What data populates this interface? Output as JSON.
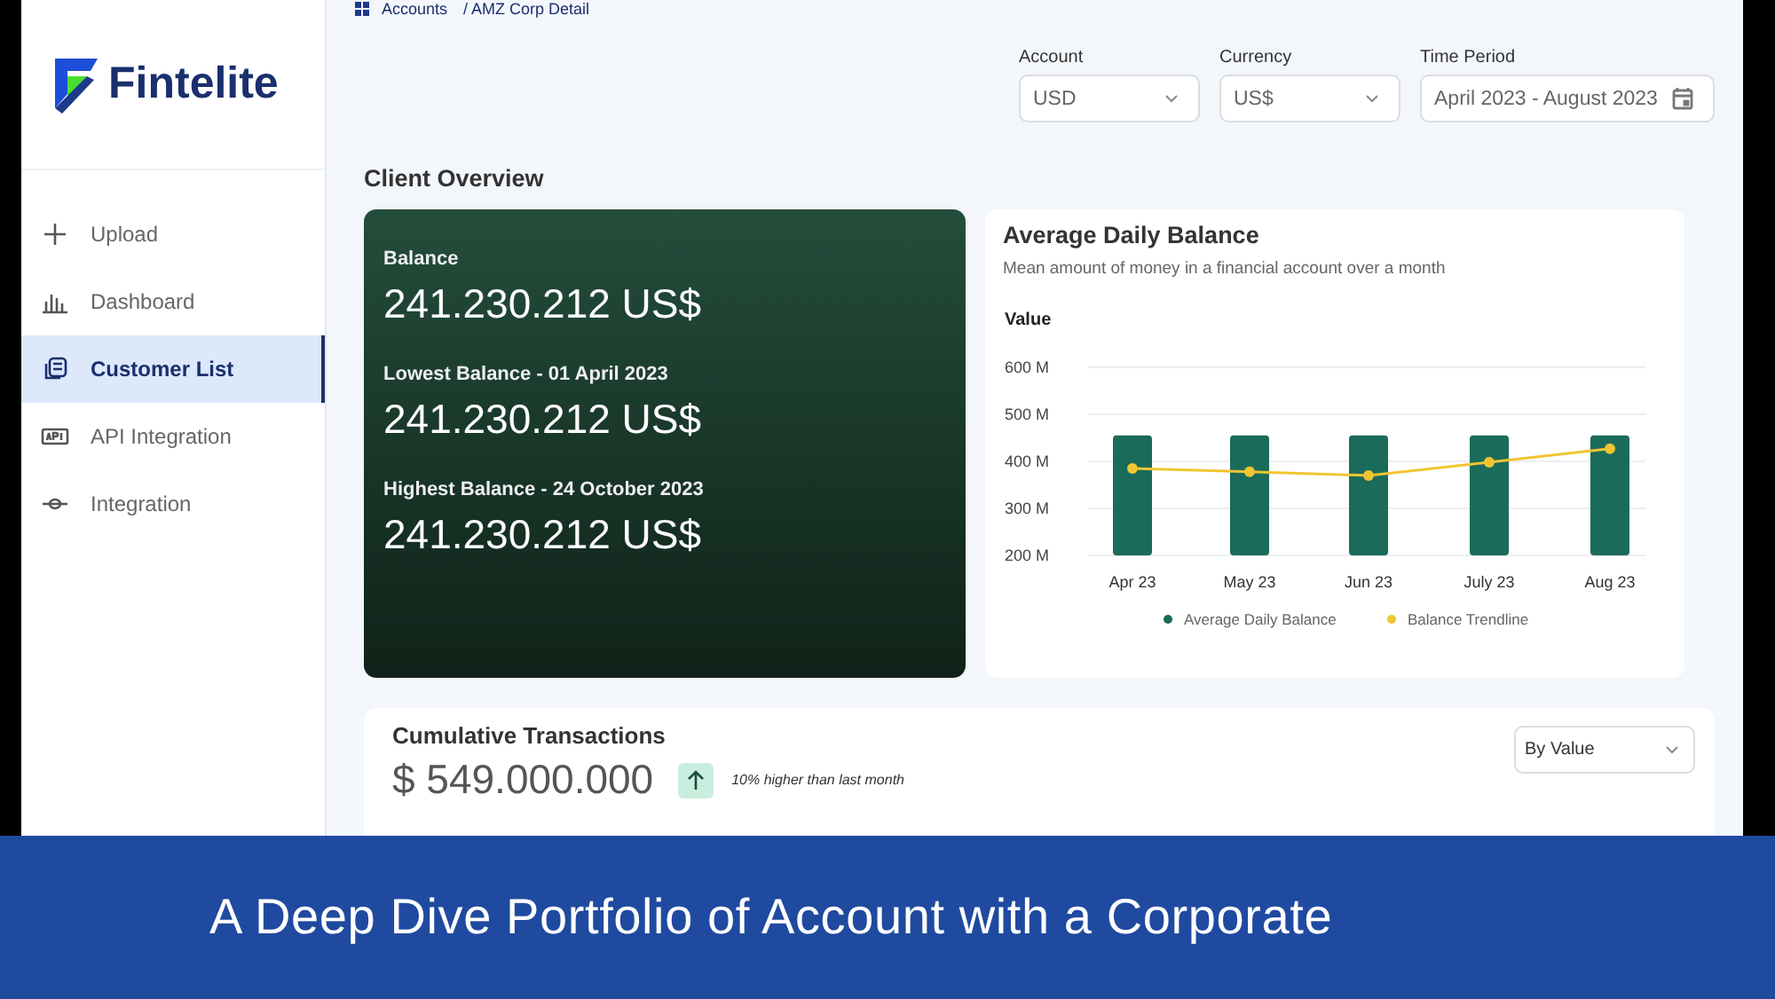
{
  "sidebar": {
    "logo": "Fintelite",
    "items": [
      {
        "label": "Upload",
        "selected": false
      },
      {
        "label": "Dashboard",
        "selected": false
      },
      {
        "label": "Customer List",
        "selected": true
      },
      {
        "label": "API Integration",
        "selected": false
      },
      {
        "label": "Integration",
        "selected": false
      }
    ]
  },
  "breadcrumb": [
    "Accounts",
    "/ AMZ Corp Detail"
  ],
  "filters": [
    {
      "label": "Account",
      "value": "USD",
      "kind": "select"
    },
    {
      "label": "Currency",
      "value": "US$",
      "kind": "select"
    },
    {
      "label": "Time Period",
      "value": "April 2023 - August 2023",
      "kind": "date"
    }
  ],
  "section_title": "Client Overview",
  "balance_card": [
    {
      "label": "Balance",
      "value": "241.230.212 US$"
    },
    {
      "label": "Lowest  Balance - 01 April 2023",
      "value": "241.230.212 US$"
    },
    {
      "label": "Highest Balance - 24 October 2023",
      "value": "241.230.212 US$"
    }
  ],
  "daily_balance": {
    "title": "Average Daily Balance",
    "subtitle": "Mean amount of money in a financial account over a month",
    "chart_data": {
      "type": "bar",
      "stacked": false,
      "grid": true,
      "legend": "bottom",
      "ylabel": "Value",
      "categories": [
        "Apr 23",
        "May 23",
        "Jun 23",
        "July 23",
        "Aug 23"
      ],
      "ylim": [
        200,
        600
      ],
      "yticks": [
        {
          "value": 200,
          "label": "200 M"
        },
        {
          "value": 300,
          "label": "300 M"
        },
        {
          "value": 400,
          "label": "400 M"
        },
        {
          "value": 500,
          "label": "500 M"
        },
        {
          "value": 600,
          "label": "600 M"
        }
      ],
      "series": [
        {
          "name": "Average Daily Balance",
          "color": "#1b6b5a",
          "type": "bar",
          "values": [
            455,
            455,
            455,
            455,
            455
          ]
        },
        {
          "name": "Balance Trendline",
          "color": "#f0c531",
          "type": "line",
          "marker": "circle",
          "values": [
            385,
            378,
            370,
            398,
            427
          ]
        }
      ]
    }
  },
  "cumulative": {
    "title": "Cumulative Transactions",
    "amount": "$ 549.000.000",
    "change": "10% higher than last month",
    "sort": "By Value"
  },
  "caption": "A Deep Dive Portfolio of Account with a Corporate"
}
